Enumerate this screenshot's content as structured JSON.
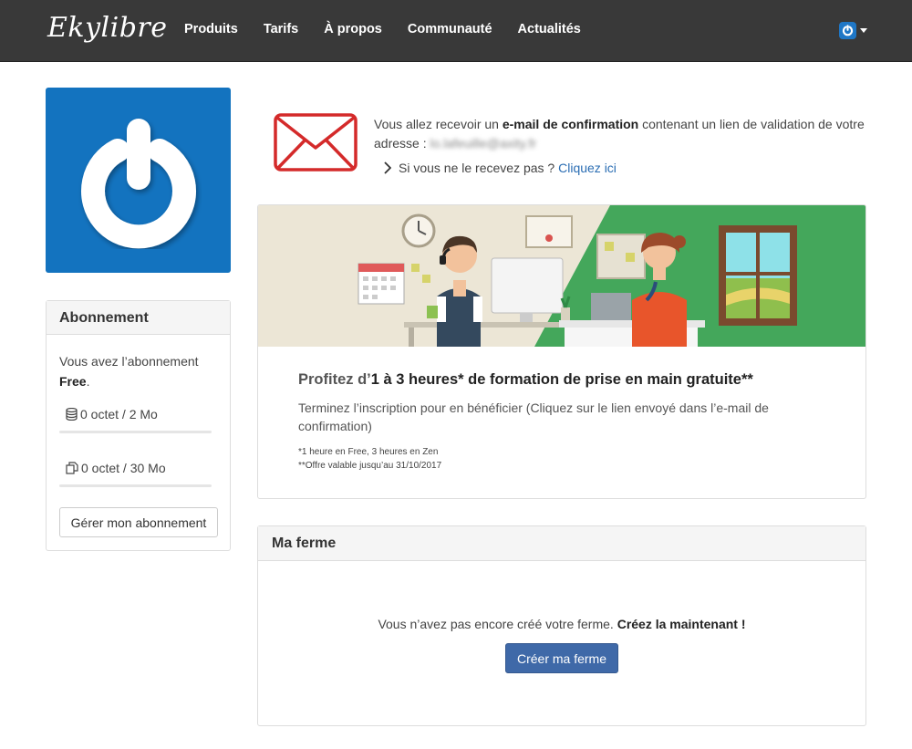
{
  "navbar": {
    "brand": "Ekylibre",
    "items": [
      {
        "label": "Produits"
      },
      {
        "label": "Tarifs"
      },
      {
        "label": "À propos"
      },
      {
        "label": "Communauté"
      },
      {
        "label": "Actualités"
      }
    ]
  },
  "subscription": {
    "title": "Abonnement",
    "text_prefix": "Vous avez l’abonnement",
    "plan": "Free",
    "plan_suffix": ".",
    "quotas": [
      {
        "icon": "database-icon",
        "label": "0 octet / 2 Mo",
        "fill": 0
      },
      {
        "icon": "documents-icon",
        "label": "0 octet / 30 Mo",
        "fill": 0
      }
    ],
    "manage_button": "Gérer mon abonnement"
  },
  "email_notice": {
    "text_before": "Vous allez recevoir un",
    "text_bold": "e-mail de confirmation",
    "text_after": "contenant un lien de validation de votre adresse :",
    "email_address": "lo.lafeuille@axity.fr",
    "resend_text": "Si vous ne le recevez pas ?",
    "resend_link": "Cliquez ici"
  },
  "promo": {
    "title_prefix": "Profitez d’",
    "title_bold": "1 à 3 heures* de formation de prise en main gratuite**",
    "description": "Terminez l’inscription pour en bénéficier (Cliquez sur le lien envoyé dans l’e-mail de confirmation)",
    "note1": "*1 heure en Free, 3 heures en Zen",
    "note2": "**Offre valable jusqu’au 31/10/2017"
  },
  "farm": {
    "title": "Ma ferme",
    "text": "Vous n’avez pas encore créé votre ferme.",
    "text_bold": "Créez la maintenant !",
    "create_button": "Créer ma ferme"
  },
  "colors": {
    "navbar_bg": "#393939",
    "brand_blue": "#1373bf",
    "primary_button": "#3f69a8",
    "link": "#2a6db3",
    "promo_green": "#44a75b",
    "envelope_red": "#d42a2a"
  }
}
